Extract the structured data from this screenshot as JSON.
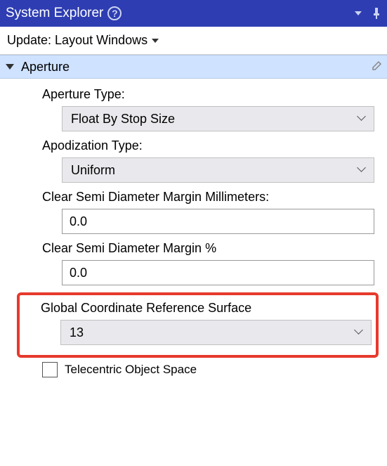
{
  "titlebar": {
    "title": "System Explorer"
  },
  "toolbar": {
    "update_label": "Update: Layout Windows"
  },
  "section": {
    "aperture_title": "Aperture"
  },
  "fields": {
    "aperture_type": {
      "label": "Aperture Type:",
      "value": "Float By Stop Size"
    },
    "apodization_type": {
      "label": "Apodization Type:",
      "value": "Uniform"
    },
    "csd_mm": {
      "label": "Clear Semi Diameter Margin Millimeters:",
      "value": "0.0"
    },
    "csd_pct": {
      "label": "Clear Semi Diameter Margin %",
      "value": "0.0"
    },
    "global_coord": {
      "label": "Global Coordinate Reference Surface",
      "value": "13"
    },
    "telecentric": {
      "label": "Telecentric Object Space"
    }
  }
}
